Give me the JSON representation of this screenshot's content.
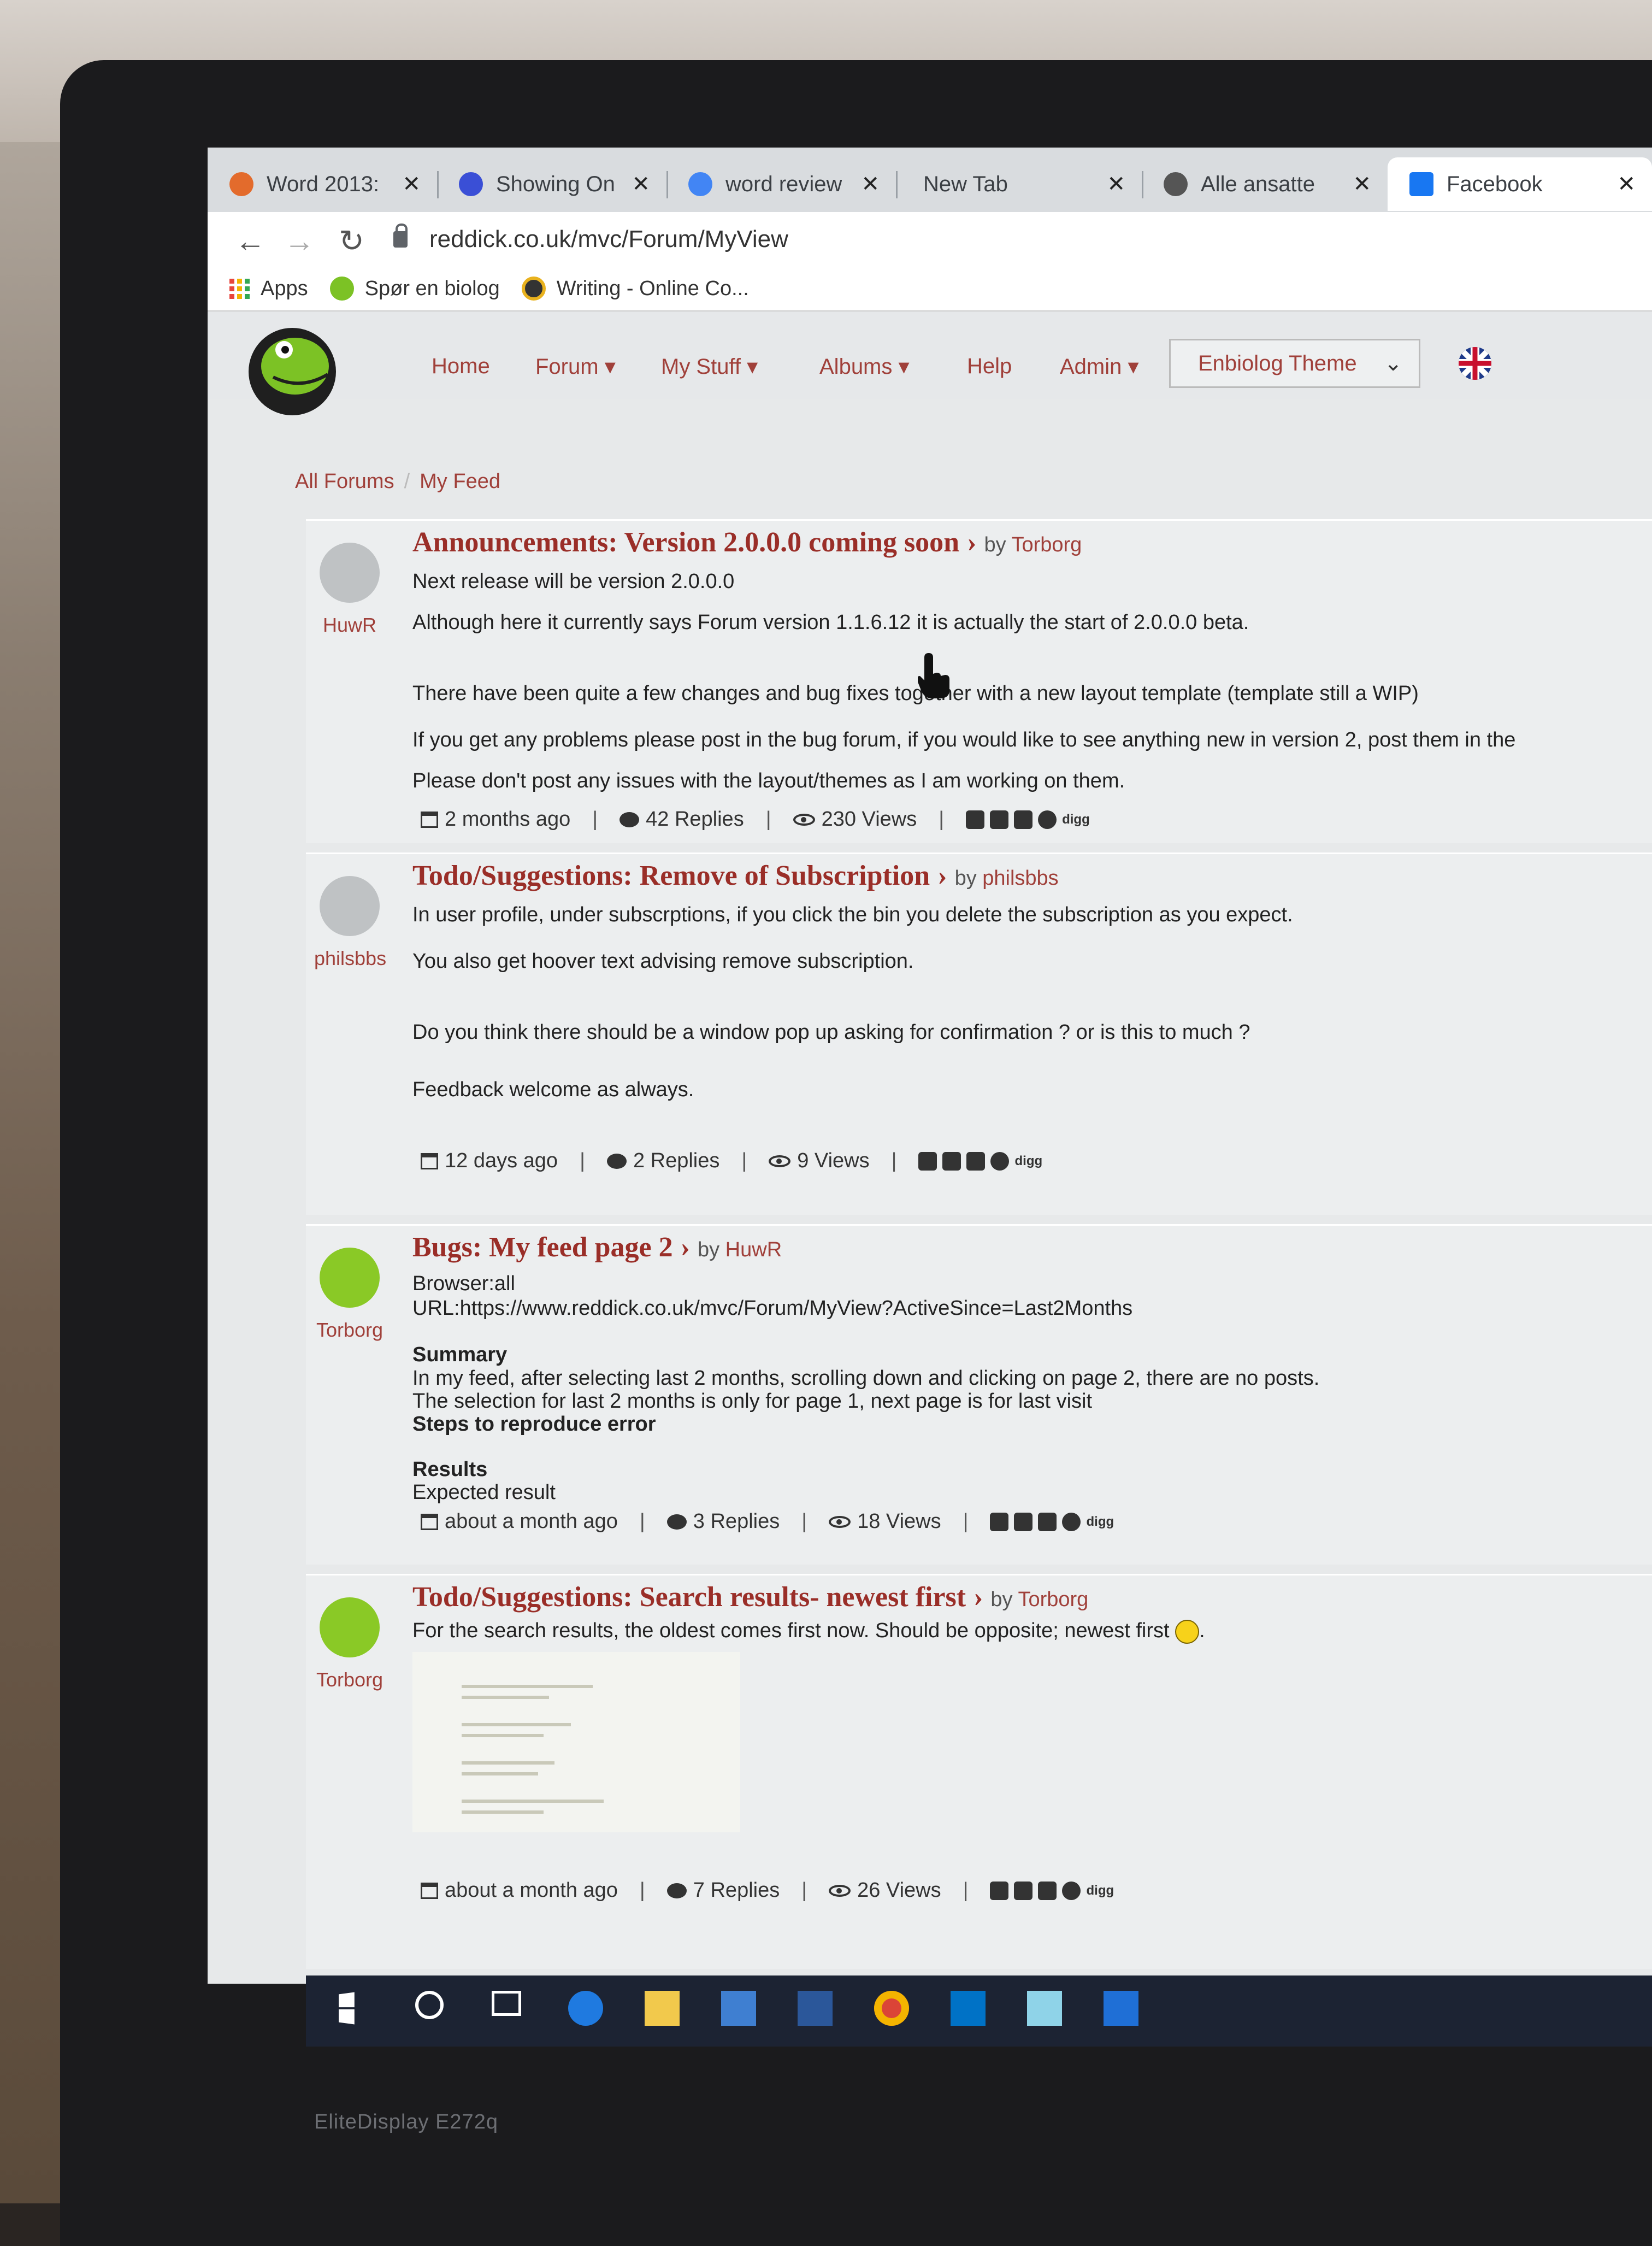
{
  "monitor_brand": "EliteDisplay E272q",
  "tabs": [
    {
      "label": "Word 2013:",
      "icon": "office-icon",
      "color": "#e36b2c"
    },
    {
      "label": "Showing On",
      "icon": "showing-icon",
      "color": "#3a4fd6"
    },
    {
      "label": "word review",
      "icon": "google-icon",
      "color": "#4285f4"
    },
    {
      "label": "New Tab",
      "icon": "",
      "color": ""
    },
    {
      "label": "Alle ansatte",
      "icon": "globe-icon",
      "color": "#555555"
    },
    {
      "label": "Facebook",
      "icon": "facebook-icon",
      "color": "#1877f2"
    }
  ],
  "url": "reddick.co.uk/mvc/Forum/MyView",
  "bookmarks": [
    "Apps",
    "Spør en biolog",
    "Writing - Online Co..."
  ],
  "nav": {
    "home": "Home",
    "forum": "Forum",
    "mystuff": "My Stuff",
    "albums": "Albums",
    "help": "Help",
    "admin": "Admin",
    "theme": "Enbiolog Theme"
  },
  "breadcrumb": {
    "all": "All Forums",
    "current": "My Feed"
  },
  "posts": [
    {
      "user": "HuwR",
      "category": "Announcements:",
      "title": "Version 2.0.0.0 coming soon",
      "by": "by",
      "author": "Torborg",
      "lines": [
        "Next release will be version 2.0.0.0",
        "Although here it currently says Forum version 1.1.6.12 it is actually the start of 2.0.0.0 beta.",
        "There have been quite a few changes and bug fixes together with a new layout template (template still a WIP)",
        "If you get any problems please post in the bug forum, if you would like to see anything new in version 2, post them in the",
        "Please don't post any issues with the layout/themes as I am working on them."
      ],
      "time": "2 months ago",
      "replies": "42 Replies",
      "views": "230 Views"
    },
    {
      "user": "philsbbs",
      "category": "Todo/Suggestions:",
      "title": "Remove of Subscription",
      "by": "by",
      "author": "philsbbs",
      "lines": [
        "In user profile, under subscrptions, if you click the bin you delete the subscription as you expect.",
        "You also get hoover text advising remove subscription.",
        "Do you think there should be a window pop up asking for confirmation ? or is this to much ?",
        "Feedback welcome as always."
      ],
      "time": "12 days ago",
      "replies": "2 Replies",
      "views": "9 Views"
    },
    {
      "user": "Torborg",
      "category": "Bugs:",
      "title": "My feed page 2",
      "by": "by",
      "author": "HuwR",
      "lines": [
        "Browser:all",
        "URL:https://www.reddick.co.uk/mvc/Forum/MyView?ActiveSince=Last2Months",
        "Summary",
        "In my feed, after selecting last 2 months, scrolling down and clicking on page 2, there are no posts.",
        "The selection for last 2 months is only for page 1, next page is for last visit",
        "Steps to reproduce error",
        "Results",
        "Expected result"
      ],
      "time": "about a month ago",
      "replies": "3 Replies",
      "views": "18 Views"
    },
    {
      "user": "Torborg",
      "category": "Todo/Suggestions:",
      "title": "Search results- newest first",
      "by": "by",
      "author": "Torborg",
      "lines": [
        "For the search results, the oldest comes first now. Should be opposite; newest first"
      ],
      "time": "about a month ago",
      "replies": "7 Replies",
      "views": "26 Views"
    }
  ],
  "social_digg": "digg"
}
